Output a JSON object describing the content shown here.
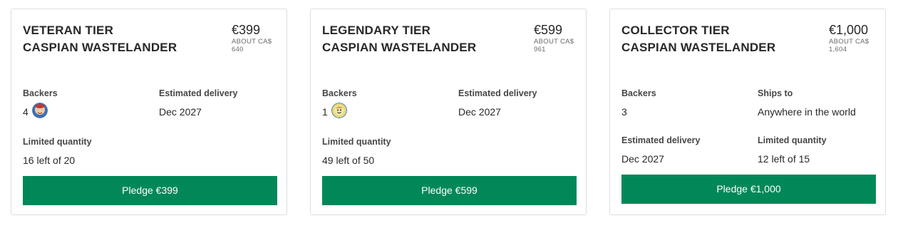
{
  "tiers": [
    {
      "title_line1": "VETERAN TIER",
      "title_line2": "CASPIAN WASTELANDER",
      "price": "€399",
      "approx_prefix": "ABOUT CA$",
      "approx_value": "640",
      "backers_label": "Backers",
      "backers_count": "4",
      "backer_avatar": "backer-avatar",
      "delivery_label": "Estimated delivery",
      "delivery_value": "Dec 2027",
      "limited_label": "Limited quantity",
      "limited_value": "16 left of 20",
      "pledge_label": "Pledge €399"
    },
    {
      "title_line1": "LEGENDARY TIER",
      "title_line2": "CASPIAN WASTELANDER",
      "price": "€599",
      "approx_prefix": "ABOUT CA$",
      "approx_value": "961",
      "backers_label": "Backers",
      "backers_count": "1",
      "backer_avatar": "backer-avatar",
      "delivery_label": "Estimated delivery",
      "delivery_value": "Dec 2027",
      "limited_label": "Limited quantity",
      "limited_value": "49 left of 50",
      "pledge_label": "Pledge €599"
    },
    {
      "title_line1": "COLLECTOR TIER",
      "title_line2": "CASPIAN WASTELANDER",
      "price": "€1,000",
      "approx_prefix": "ABOUT CA$",
      "approx_value": "1,604",
      "backers_label": "Backers",
      "backers_count": "3",
      "ships_label": "Ships to",
      "ships_value": "Anywhere in the world",
      "delivery_label": "Estimated delivery",
      "delivery_value": "Dec 2027",
      "limited_label": "Limited quantity",
      "limited_value": "12 left of 15",
      "pledge_label": "Pledge €1,000"
    }
  ],
  "colors": {
    "pledge_button": "#028858",
    "card_border": "#dcdedd",
    "text_primary": "#282828",
    "text_muted": "#6a6a6a"
  }
}
